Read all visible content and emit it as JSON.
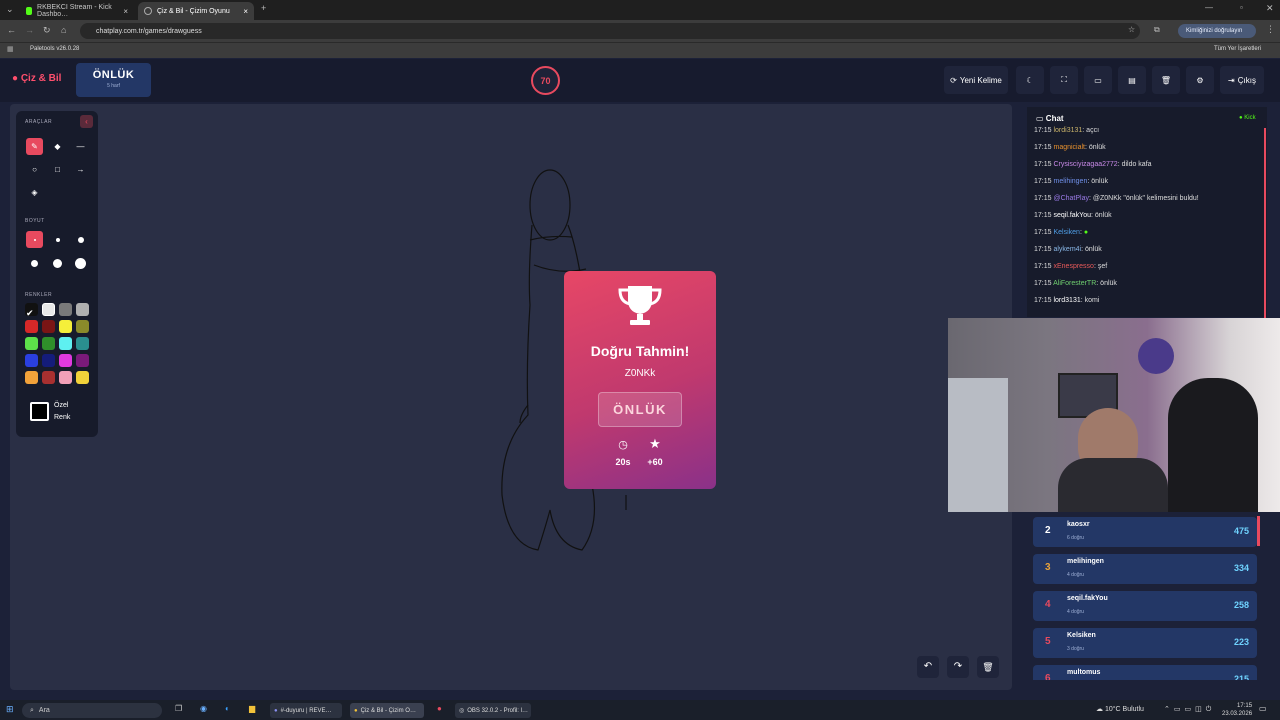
{
  "browser": {
    "tabs": [
      {
        "label": "RKBEKCI Stream - Kick Dashbo…",
        "active": false
      },
      {
        "label": "Çiz & Bil - Çizim Oyunu",
        "active": true
      }
    ],
    "url": "chatplay.com.tr/games/drawguess",
    "profile": "Kimliğinizi doğrulayın",
    "bookmark": "Paletools v26.0.28",
    "all_bookmarks": "Tüm Yer İşaretleri"
  },
  "header": {
    "logo": "Çiz & Bil",
    "word": "ÖNLÜK",
    "word_hint": "5 harf",
    "timer": "70",
    "new_word": "Yeni Kelime",
    "exit": "Çıkış"
  },
  "tools": {
    "tools_title": "ARAÇLAR",
    "size_title": "BOYUT",
    "colors_title": "RENKLER",
    "custom_color_line1": "Özel",
    "custom_color_line2": "Renk",
    "colors": [
      "#111111",
      "#e8e8e8",
      "#7a7a7a",
      "#b0b0b0",
      "#d62828",
      "#7a1515",
      "#f5ef3a",
      "#8a8a2a",
      "#5de04a",
      "#2f8f2a",
      "#5ef0f0",
      "#2a8f8f",
      "#2a3fe0",
      "#141c7a",
      "#e03adf",
      "#7a1a7a",
      "#f2a23a",
      "#a83030",
      "#f2a0b8",
      "#f2d23a"
    ]
  },
  "modal": {
    "title": "Doğru Tahmin!",
    "user": "Z0NKk",
    "word": "ÖNLÜK",
    "time": "20s",
    "points": "+60"
  },
  "chat": {
    "title": "Chat",
    "platform": "Kick",
    "messages": [
      {
        "time": "17:15",
        "user": "lordi3131",
        "text": ": açcı",
        "color": "#c9b36a"
      },
      {
        "time": "17:15",
        "user": "magnicialt",
        "text": ": önlük",
        "color": "#e8912d"
      },
      {
        "time": "17:15",
        "user": "Crysisciyizagaa2772",
        "text": ": dildo kafa",
        "color": "#c98ae8"
      },
      {
        "time": "17:15",
        "user": "melihingen",
        "text": ": önlük",
        "color": "#6f8fe8"
      },
      {
        "time": "17:15",
        "user": "@ChatPlay",
        "text": ": @Z0NKk \"önlük\" kelimesini buldu!",
        "color": "#9b7be8"
      },
      {
        "time": "17:15",
        "user": "seqil.fakYou",
        "text": ": önlük",
        "color": "#ffffff"
      },
      {
        "time": "17:15",
        "user": "Kelsiken",
        "text": ": ",
        "color": "#4f9fe8"
      },
      {
        "time": "17:15",
        "user": "alykem4i",
        "text": ": önlük",
        "color": "#8ab8e8"
      },
      {
        "time": "17:15",
        "user": "xEnespressо",
        "text": ": şef",
        "color": "#e85a5a"
      },
      {
        "time": "17:15",
        "user": "AliForesterTR",
        "text": ": önlük",
        "color": "#6fcf6f"
      },
      {
        "time": "17:15",
        "user": "lord3131",
        "text": ": komi",
        "color": "#ffffff"
      }
    ]
  },
  "leaderboard": [
    {
      "rank": "2",
      "name": "kaosxr",
      "sub": "6 doğru",
      "points": "475"
    },
    {
      "rank": "3",
      "name": "melihingen",
      "sub": "4 doğru",
      "points": "334"
    },
    {
      "rank": "4",
      "name": "seqil.fakYou",
      "sub": "4 doğru",
      "points": "258"
    },
    {
      "rank": "5",
      "name": "Kelsiken",
      "sub": "3 doğru",
      "points": "223"
    },
    {
      "rank": "6",
      "name": "multomus",
      "sub": "",
      "points": "215"
    }
  ],
  "taskbar": {
    "search": "Ara",
    "apps": [
      "#-duyuru | REVE…",
      "Çiz & Bil - Çizim O…",
      "OBS 32.0.2 - Profil: l…"
    ],
    "weather": "10°C  Bulutlu",
    "time": "17:15",
    "date": "23.03.2026"
  }
}
